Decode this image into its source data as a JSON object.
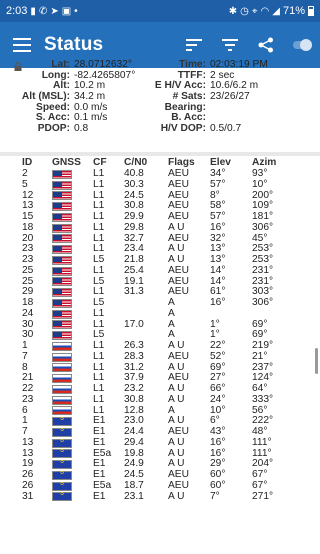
{
  "statusbar": {
    "time": "2:03",
    "battery": "71%"
  },
  "toolbar": {
    "title": "Status"
  },
  "info": {
    "rows": [
      {
        "l1": "Lat:",
        "v1": "28.0712632°",
        "l2": "Time:",
        "v2": "02:03:19 PM"
      },
      {
        "l1": "Long:",
        "v1": "-82.4265807°",
        "l2": "TTFF:",
        "v2": "2 sec"
      },
      {
        "l1": "Alt:",
        "v1": "10.2 m",
        "l2": "E H/V Acc:",
        "v2": "10.6/6.2 m"
      },
      {
        "l1": "Alt (MSL):",
        "v1": "34.2 m",
        "l2": "# Sats:",
        "v2": "23/26/27"
      },
      {
        "l1": "Speed:",
        "v1": "0.0 m/s",
        "l2": "Bearing:",
        "v2": ""
      },
      {
        "l1": "S. Acc:",
        "v1": "0.1 m/s",
        "l2": "B. Acc:",
        "v2": ""
      },
      {
        "l1": "PDOP:",
        "v1": "0.8",
        "l2": "H/V DOP:",
        "v2": "0.5/0.7"
      }
    ]
  },
  "table": {
    "headers": [
      "ID",
      "GNSS",
      "CF",
      "C/N0",
      "Flags",
      "Elev",
      "Azim"
    ],
    "rows": [
      {
        "id": "2",
        "g": "us",
        "cf": "L1",
        "cn": "40.8",
        "fl": "AEU",
        "el": "34°",
        "az": "93°"
      },
      {
        "id": "5",
        "g": "us",
        "cf": "L1",
        "cn": "30.3",
        "fl": "AEU",
        "el": "57°",
        "az": "10°"
      },
      {
        "id": "12",
        "g": "us",
        "cf": "L1",
        "cn": "24.5",
        "fl": "AEU",
        "el": "8°",
        "az": "200°"
      },
      {
        "id": "13",
        "g": "us",
        "cf": "L1",
        "cn": "30.8",
        "fl": "AEU",
        "el": "58°",
        "az": "109°"
      },
      {
        "id": "15",
        "g": "us",
        "cf": "L1",
        "cn": "29.9",
        "fl": "AEU",
        "el": "57°",
        "az": "181°"
      },
      {
        "id": "18",
        "g": "us",
        "cf": "L1",
        "cn": "29.8",
        "fl": "A U",
        "el": "16°",
        "az": "306°"
      },
      {
        "id": "20",
        "g": "us",
        "cf": "L1",
        "cn": "32.7",
        "fl": "AEU",
        "el": "32°",
        "az": "45°"
      },
      {
        "id": "23",
        "g": "us",
        "cf": "L1",
        "cn": "23.4",
        "fl": "A U",
        "el": "13°",
        "az": "253°"
      },
      {
        "id": "23",
        "g": "us",
        "cf": "L5",
        "cn": "21.8",
        "fl": "A U",
        "el": "13°",
        "az": "253°"
      },
      {
        "id": "25",
        "g": "us",
        "cf": "L1",
        "cn": "25.4",
        "fl": "AEU",
        "el": "14°",
        "az": "231°"
      },
      {
        "id": "25",
        "g": "us",
        "cf": "L5",
        "cn": "19.1",
        "fl": "AEU",
        "el": "14°",
        "az": "231°"
      },
      {
        "id": "29",
        "g": "us",
        "cf": "L1",
        "cn": "31.3",
        "fl": "AEU",
        "el": "61°",
        "az": "303°"
      },
      {
        "id": "18",
        "g": "us",
        "cf": "L5",
        "cn": "",
        "fl": "A",
        "el": "16°",
        "az": "306°"
      },
      {
        "id": "24",
        "g": "us",
        "cf": "L1",
        "cn": "",
        "fl": "A",
        "el": "",
        "az": ""
      },
      {
        "id": "30",
        "g": "us",
        "cf": "L1",
        "cn": "17.0",
        "fl": "A",
        "el": "1°",
        "az": "69°"
      },
      {
        "id": "30",
        "g": "us",
        "cf": "L5",
        "cn": "",
        "fl": "A",
        "el": "1°",
        "az": "69°"
      },
      {
        "id": "1",
        "g": "ru",
        "cf": "L1",
        "cn": "26.3",
        "fl": "A U",
        "el": "22°",
        "az": "219°"
      },
      {
        "id": "7",
        "g": "ru",
        "cf": "L1",
        "cn": "28.3",
        "fl": "AEU",
        "el": "52°",
        "az": "21°"
      },
      {
        "id": "8",
        "g": "ru",
        "cf": "L1",
        "cn": "31.2",
        "fl": "A U",
        "el": "69°",
        "az": "237°"
      },
      {
        "id": "21",
        "g": "ru",
        "cf": "L1",
        "cn": "37.9",
        "fl": "AEU",
        "el": "27°",
        "az": "124°"
      },
      {
        "id": "22",
        "g": "ru",
        "cf": "L1",
        "cn": "23.2",
        "fl": "A U",
        "el": "66°",
        "az": "64°"
      },
      {
        "id": "23",
        "g": "ru",
        "cf": "L1",
        "cn": "30.8",
        "fl": "A U",
        "el": "24°",
        "az": "333°"
      },
      {
        "id": "6",
        "g": "ru",
        "cf": "L1",
        "cn": "12.8",
        "fl": "A",
        "el": "10°",
        "az": "56°"
      },
      {
        "id": "1",
        "g": "eu",
        "cf": "E1",
        "cn": "23.0",
        "fl": "A U",
        "el": "6°",
        "az": "222°"
      },
      {
        "id": "7",
        "g": "eu",
        "cf": "E1",
        "cn": "24.4",
        "fl": "AEU",
        "el": "43°",
        "az": "48°"
      },
      {
        "id": "13",
        "g": "eu",
        "cf": "E1",
        "cn": "29.4",
        "fl": "A U",
        "el": "16°",
        "az": "111°"
      },
      {
        "id": "13",
        "g": "eu",
        "cf": "E5a",
        "cn": "19.8",
        "fl": "A U",
        "el": "16°",
        "az": "111°"
      },
      {
        "id": "19",
        "g": "eu",
        "cf": "E1",
        "cn": "24.9",
        "fl": "A U",
        "el": "29°",
        "az": "204°"
      },
      {
        "id": "26",
        "g": "eu",
        "cf": "E1",
        "cn": "24.5",
        "fl": "AEU",
        "el": "60°",
        "az": "67°"
      },
      {
        "id": "26",
        "g": "eu",
        "cf": "E5a",
        "cn": "18.7",
        "fl": "AEU",
        "el": "60°",
        "az": "67°"
      },
      {
        "id": "31",
        "g": "eu",
        "cf": "E1",
        "cn": "23.1",
        "fl": "A U",
        "el": "7°",
        "az": "271°"
      }
    ]
  }
}
